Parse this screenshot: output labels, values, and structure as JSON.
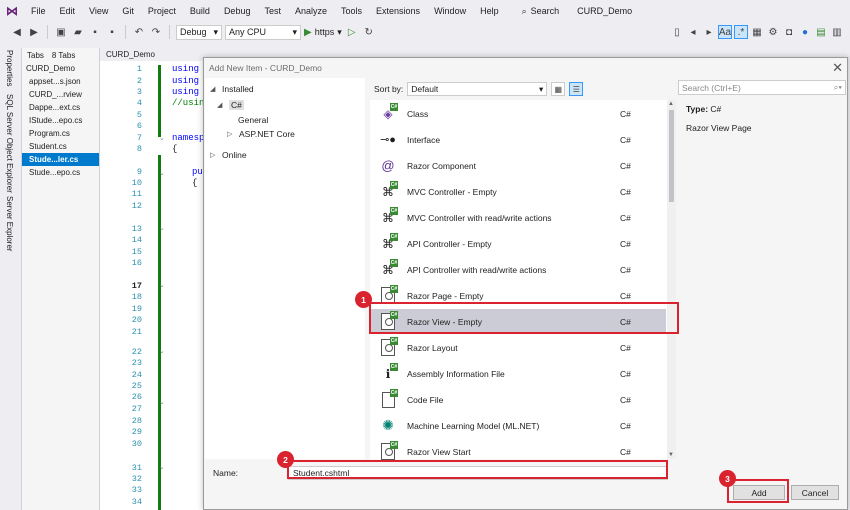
{
  "menu": {
    "items": [
      "File",
      "Edit",
      "View",
      "Git",
      "Project",
      "Build",
      "Debug",
      "Test",
      "Analyze",
      "Tools",
      "Extensions",
      "Window",
      "Help"
    ],
    "search_label": "Search",
    "solution_title": "CURD_Demo"
  },
  "toolbar": {
    "config": "Debug",
    "platform": "Any CPU",
    "run_label": "https"
  },
  "side_strip": {
    "labels": [
      "Properties",
      "SQL Server Object Explorer",
      "Server Explorer"
    ]
  },
  "tabs_panel": {
    "title": "Tabs",
    "count": "8 Tabs",
    "root": "CURD_Demo",
    "files": [
      {
        "name": "appset...s.json",
        "active": false
      },
      {
        "name": "CURD_...rview",
        "active": false
      },
      {
        "name": "Dappe...ext.cs",
        "active": false
      },
      {
        "name": "IStude...epo.cs",
        "active": false
      },
      {
        "name": "Program.cs",
        "active": false
      },
      {
        "name": "Student.cs",
        "active": false
      },
      {
        "name": "Stude...ler.cs",
        "active": true
      },
      {
        "name": "Stude...epo.cs",
        "active": false
      }
    ]
  },
  "editor": {
    "doc_tab": "CURD_Demo",
    "line_numbers": [
      "1",
      "2",
      "3",
      "4",
      "5",
      "6",
      "7",
      "8",
      "9",
      "10",
      "11",
      "12",
      "13",
      "14",
      "15",
      "16",
      "17",
      "18",
      "19",
      "20",
      "21",
      "22",
      "23",
      "24",
      "25",
      "26",
      "27",
      "28",
      "29",
      "30",
      "31",
      "32",
      "33",
      "34"
    ],
    "code": {
      "using1": "using",
      "using2": "using",
      "using3": "using",
      "using4": "//usin",
      "namespace": "namesp",
      "brace": "{",
      "public": "pu",
      "brace2": "{"
    }
  },
  "dialog": {
    "title": "Add New Item - CURD_Demo",
    "close": "✕",
    "tree": {
      "installed": "Installed",
      "csharp": "C#",
      "general": "General",
      "aspnet": "ASP.NET Core",
      "online": "Online"
    },
    "sort_label": "Sort by:",
    "sort_value": "Default",
    "search_placeholder": "Search (Ctrl+E)",
    "templates": [
      {
        "name": "Class",
        "lang": "C#",
        "icon": "class-icon"
      },
      {
        "name": "Interface",
        "lang": "C#",
        "icon": "interface-icon"
      },
      {
        "name": "Razor Component",
        "lang": "C#",
        "icon": "razor-component-icon"
      },
      {
        "name": "MVC Controller - Empty",
        "lang": "C#",
        "icon": "controller-icon"
      },
      {
        "name": "MVC Controller with read/write actions",
        "lang": "C#",
        "icon": "controller-icon"
      },
      {
        "name": "API Controller - Empty",
        "lang": "C#",
        "icon": "controller-icon"
      },
      {
        "name": "API Controller with read/write actions",
        "lang": "C#",
        "icon": "controller-icon"
      },
      {
        "name": "Razor Page - Empty",
        "lang": "C#",
        "icon": "razor-page-icon"
      },
      {
        "name": "Razor View - Empty",
        "lang": "C#",
        "icon": "razor-view-icon"
      },
      {
        "name": "Razor Layout",
        "lang": "C#",
        "icon": "razor-layout-icon"
      },
      {
        "name": "Assembly Information File",
        "lang": "C#",
        "icon": "assembly-info-icon"
      },
      {
        "name": "Code File",
        "lang": "C#",
        "icon": "code-file-icon"
      },
      {
        "name": "Machine Learning Model (ML.NET)",
        "lang": "C#",
        "icon": "ml-model-icon"
      },
      {
        "name": "Razor View Start",
        "lang": "C#",
        "icon": "razor-view-start-icon"
      }
    ],
    "details": {
      "type_label": "Type:",
      "type_value": "C#",
      "description": "Razor View Page"
    },
    "name_label": "Name:",
    "name_value": "Student.cshtml",
    "add_label": "Add",
    "cancel_label": "Cancel"
  },
  "annotations": {
    "step1": "1",
    "step2": "2",
    "step3": "3",
    "color": "#d9232e"
  },
  "colors": {
    "accent": "#007acc",
    "selection": "#ccccd6",
    "csharp_badge": "#388a34"
  }
}
